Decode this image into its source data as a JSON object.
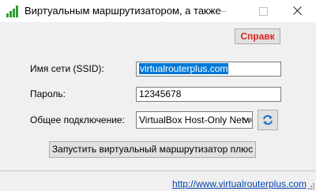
{
  "window": {
    "title": "Виртуальным маршрутизатором, а также",
    "icon": "antenna-app-icon"
  },
  "toolbar": {
    "help_label": "Справк",
    "help_color": "#e02020"
  },
  "form": {
    "ssid_label": "Имя сети (SSID):",
    "ssid_value": "virtualrouterplus.com",
    "password_label": "Пароль:",
    "password_value": "12345678",
    "shared_label": "Общее подключение:",
    "shared_value": "VirtualBox Host-Only Network"
  },
  "actions": {
    "start_label": "Запустить виртуальный маршрутизатор плюс"
  },
  "footer": {
    "link_text": "http://www.virtualrouterplus.com",
    "link_color": "#0645ad"
  },
  "colors": {
    "selection": "#0078d7",
    "background": "#f0f0f0"
  }
}
